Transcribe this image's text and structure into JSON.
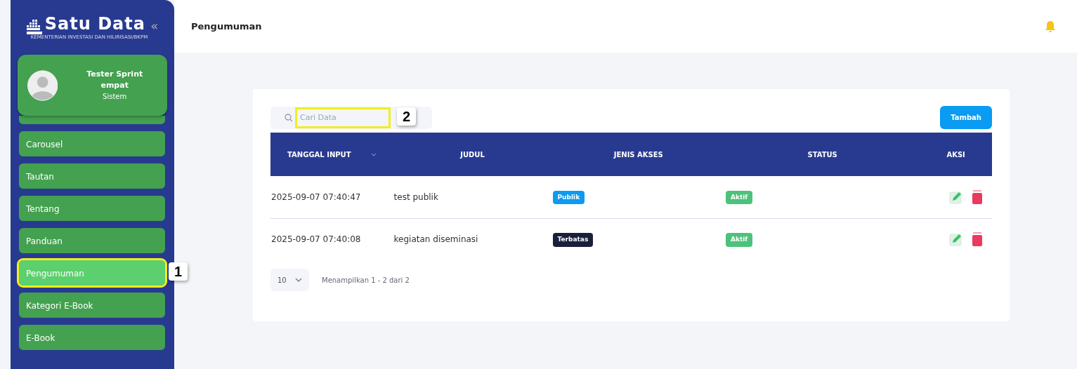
{
  "logo": {
    "title": "Satu Data",
    "subtitle": "KEMENTERIAN INVESTASI DAN HILIRISASI/BKPM",
    "collapse": "«"
  },
  "profile": {
    "name": "Tester Sprint empat",
    "role": "Sistem"
  },
  "sidebar": {
    "items": [
      {
        "selected": false
      },
      {
        "label": "Carousel",
        "selected": false
      },
      {
        "label": "Tautan",
        "selected": false
      },
      {
        "label": "Tentang",
        "selected": false
      },
      {
        "label": "Panduan",
        "selected": false
      },
      {
        "label": "Pengumuman",
        "selected": true,
        "annotation": "1"
      },
      {
        "label": "Kategori E-Book",
        "selected": false
      },
      {
        "label": "E-Book",
        "selected": false
      }
    ]
  },
  "header": {
    "title": "Pengumuman"
  },
  "search": {
    "placeholder": "Cari Data",
    "annotation": "2"
  },
  "add_button": "Tambah",
  "table": {
    "columns": [
      {
        "label": "TANGGAL INPUT",
        "sortable": true
      },
      {
        "label": "JUDUL",
        "sortable": false
      },
      {
        "label": "JENIS AKSES",
        "sortable": false
      },
      {
        "label": "STATUS",
        "sortable": false
      },
      {
        "label": "AKSI",
        "sortable": false
      }
    ],
    "rows": [
      {
        "date": "2025-09-07 07:40:47",
        "title": "test publik",
        "access": "Publik",
        "kind": "public",
        "status": "Aktif"
      },
      {
        "date": "2025-09-07 07:40:08",
        "title": "kegiatan diseminasi",
        "access": "Terbatas",
        "kind": "restricted",
        "status": "Aktif"
      }
    ]
  },
  "pagination": {
    "page_size": "10",
    "summary": "Menampilkan 1 - 2 dari 2"
  }
}
